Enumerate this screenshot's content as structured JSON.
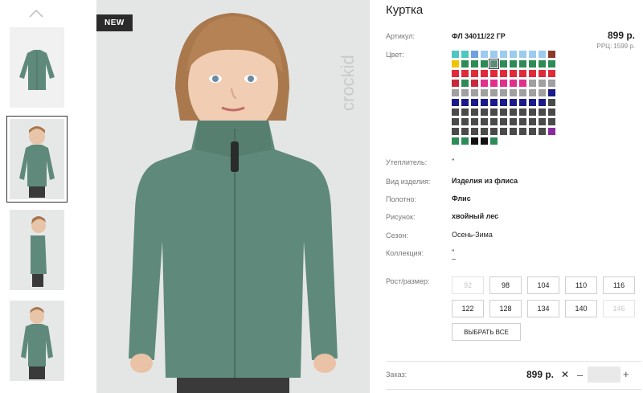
{
  "badge_new": "NEW",
  "brand_text": "crockid",
  "product": {
    "title": "Куртка",
    "article_label": "Артикул:",
    "article_value": "ФЛ 34011/22 ГР",
    "price": "899 р.",
    "rrp_label": "РРЦ:",
    "rrp_value": "1599 р.",
    "color_label": "Цвет:"
  },
  "colors": [
    "#4fc6c0",
    "#4fc6c0",
    "#6fa0e0",
    "#9ccbf0",
    "#9ccbf0",
    "#9ccbf0",
    "#9ccbf0",
    "#9ccbf0",
    "#9ccbf0",
    "#9ccbf0",
    "#8b3a2a",
    "#f0c400",
    "#2e8b57",
    "#2e8b57",
    "#2e8b57",
    "#5a8a7a",
    "#2e8b57",
    "#2e8b57",
    "#2e8b57",
    "#2e8b57",
    "#2e8b57",
    "#2e8b57",
    "#e02a3a",
    "#e02a3a",
    "#e02a3a",
    "#e02a3a",
    "#e02a3a",
    "#e02a3a",
    "#e02a3a",
    "#e02a3a",
    "#e02a3a",
    "#e02a3a",
    "#e02a3a",
    "#c8283a",
    "#2e8b57",
    "#c8283a",
    "#e0308c",
    "#e0308c",
    "#e0308c",
    "#e0308c",
    "#e0308c",
    "#a0a0a0",
    "#a0a0a0",
    "#a0a0a0",
    "#a0a0a0",
    "#a0a0a0",
    "#a0a0a0",
    "#a0a0a0",
    "#a0a0a0",
    "#a0a0a0",
    "#a0a0a0",
    "#a0a0a0",
    "#a0a0a0",
    "#a0a0a0",
    "#1a1a8a",
    "#1a1a8a",
    "#1a1a8a",
    "#1a1a8a",
    "#1a1a8a",
    "#1a1a8a",
    "#1a1a8a",
    "#1a1a8a",
    "#1a1a8a",
    "#1a1a8a",
    "#1a1a8a",
    "#4a4a4a",
    "#4a4a4a",
    "#4a4a4a",
    "#4a4a4a",
    "#4a4a4a",
    "#4a4a4a",
    "#4a4a4a",
    "#4a4a4a",
    "#4a4a4a",
    "#4a4a4a",
    "#4a4a4a",
    "#4a4a4a",
    "#4a4a4a",
    "#4a4a4a",
    "#4a4a4a",
    "#4a4a4a",
    "#4a4a4a",
    "#4a4a4a",
    "#4a4a4a",
    "#4a4a4a",
    "#4a4a4a",
    "#4a4a4a",
    "#4a4a4a",
    "#4a4a4a",
    "#4a4a4a",
    "#4a4a4a",
    "#4a4a4a",
    "#4a4a4a",
    "#4a4a4a",
    "#4a4a4a",
    "#4a4a4a",
    "#4a4a4a",
    "#4a4a4a",
    "#8a2aa0",
    "#2e8b57",
    "#2e8b57",
    "#111111",
    "#111111",
    "#2e8b57"
  ],
  "selected_color_index": 15,
  "attributes": [
    {
      "label": "Утеплитель:",
      "value": "\"",
      "bold": false
    },
    {
      "label": "Вид изделия:",
      "value": "Изделия из флиса",
      "bold": true
    },
    {
      "label": "Полотно:",
      "value": "Флис",
      "bold": true
    },
    {
      "label": "Рисунок:",
      "value": "хвойный лес",
      "bold": true
    },
    {
      "label": "Сезон:",
      "value": "Осень-Зима",
      "bold": false
    },
    {
      "label": "Коллекция:",
      "value": "\"\n–",
      "bold": false
    }
  ],
  "sizes_label": "Рост/размер:",
  "sizes": [
    {
      "value": "92",
      "disabled": true
    },
    {
      "value": "98",
      "disabled": false
    },
    {
      "value": "104",
      "disabled": false
    },
    {
      "value": "110",
      "disabled": false
    },
    {
      "value": "116",
      "disabled": false
    },
    {
      "value": "122",
      "disabled": false
    },
    {
      "value": "128",
      "disabled": false
    },
    {
      "value": "134",
      "disabled": false
    },
    {
      "value": "140",
      "disabled": false
    },
    {
      "value": "146",
      "disabled": true
    }
  ],
  "select_all_label": "ВЫБРАТЬ ВСЕ",
  "order": {
    "label": "Заказ:",
    "total": "899 р.",
    "remove_symbol": "✕",
    "minus_symbol": "–",
    "plus_symbol": "+",
    "quantity": ""
  },
  "accent_colors": {
    "jacket": "#5f8a7b",
    "badge": "#2b2b2b"
  }
}
